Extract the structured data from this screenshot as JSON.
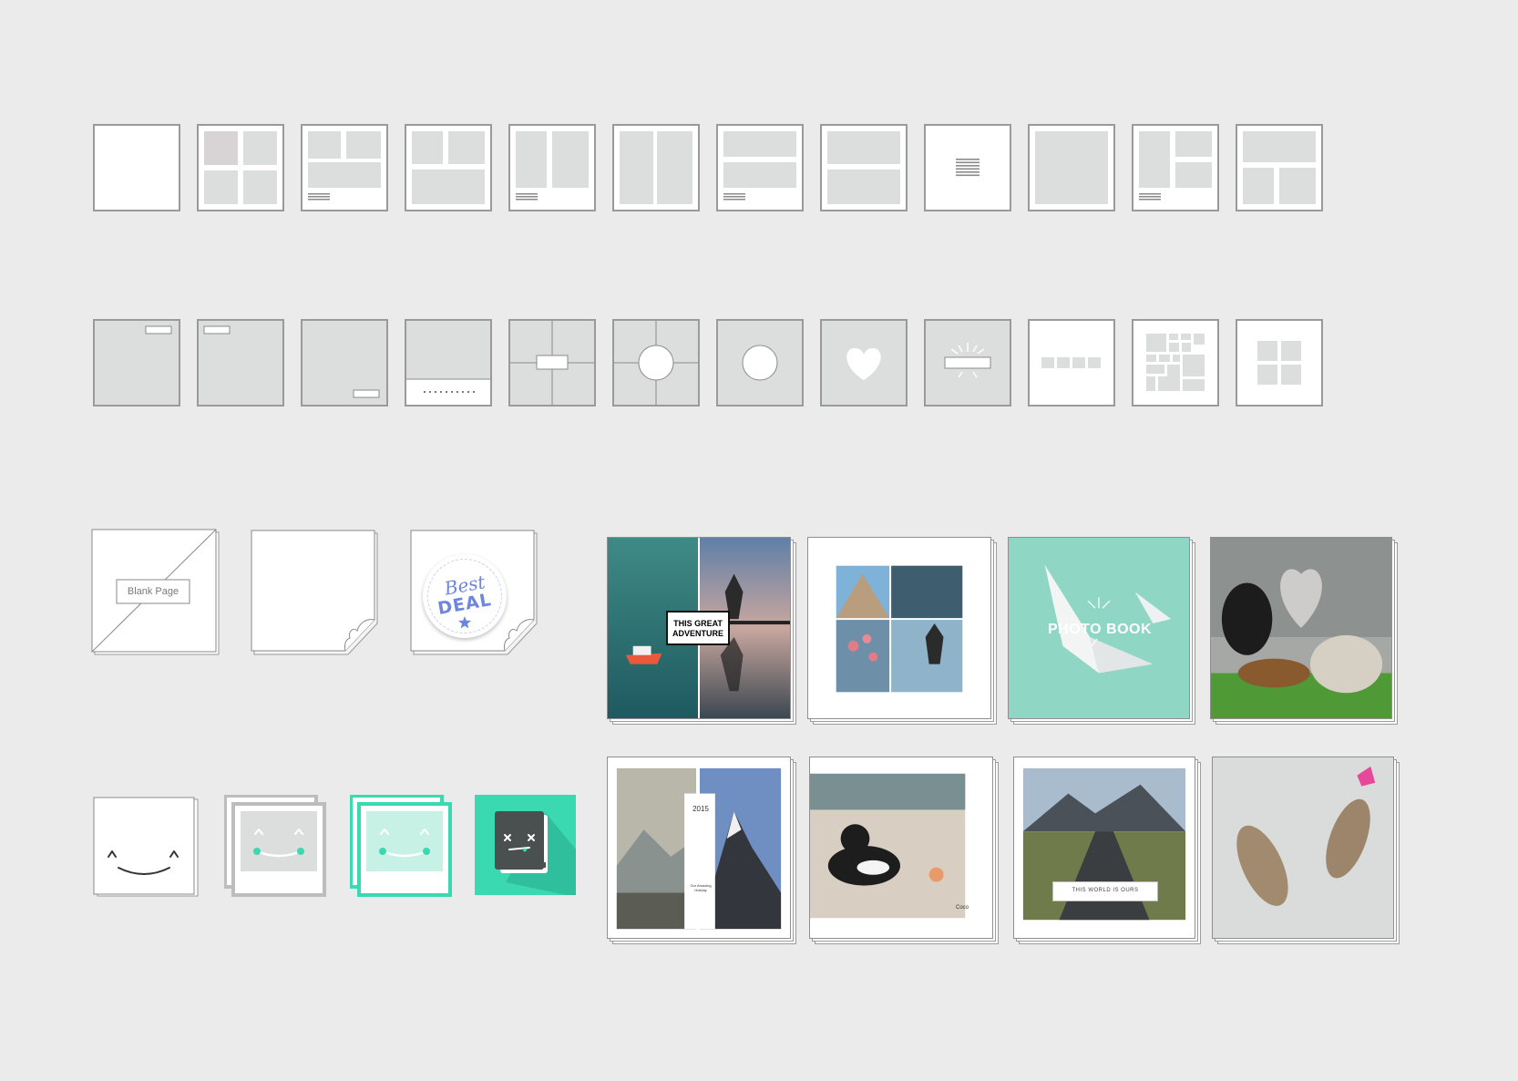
{
  "layouts_row1": [
    {
      "name": "layout-blank"
    },
    {
      "name": "layout-four-grid"
    },
    {
      "name": "layout-two-top-wide-caption"
    },
    {
      "name": "layout-two-top-wide-bottom"
    },
    {
      "name": "layout-two-column-caption"
    },
    {
      "name": "layout-two-column"
    },
    {
      "name": "layout-two-rows-caption"
    },
    {
      "name": "layout-two-rows"
    },
    {
      "name": "layout-text-only"
    },
    {
      "name": "layout-single-photo"
    },
    {
      "name": "layout-three-caption"
    },
    {
      "name": "layout-wide-top-two-bottom"
    }
  ],
  "layouts_row2": [
    {
      "name": "cover-label-top-right"
    },
    {
      "name": "cover-label-top-left"
    },
    {
      "name": "cover-label-bottom-right"
    },
    {
      "name": "cover-dotted-band"
    },
    {
      "name": "cover-center-label-quadrants"
    },
    {
      "name": "cover-center-circle-quadrants"
    },
    {
      "name": "cover-center-circle"
    },
    {
      "name": "cover-heart"
    },
    {
      "name": "cover-burst-label"
    },
    {
      "name": "cover-four-squares-strip"
    },
    {
      "name": "cover-mosaic"
    },
    {
      "name": "cover-four-grid-center"
    }
  ],
  "blank_page": {
    "label": "Blank Page"
  },
  "badge": {
    "line1": "Best",
    "line2": "DEAL"
  },
  "previews": {
    "adventure_title_line1": "THIS GREAT",
    "adventure_title_line2": "ADVENTURE",
    "photo_book_title": "PHOTO BOOK",
    "holiday_year": "2015",
    "holiday_caption_line1": "Our Amazing",
    "holiday_caption_line2": "Holiday",
    "dog_caption": "Coco",
    "road_caption": "THIS WORLD IS OURS"
  },
  "colors": {
    "background": "#ebebeb",
    "placeholder_gray": "#dcdedd",
    "border_gray": "#9a9a9a",
    "accent_teal": "#3ad9b1",
    "badge_blue": "#6f86e0"
  }
}
